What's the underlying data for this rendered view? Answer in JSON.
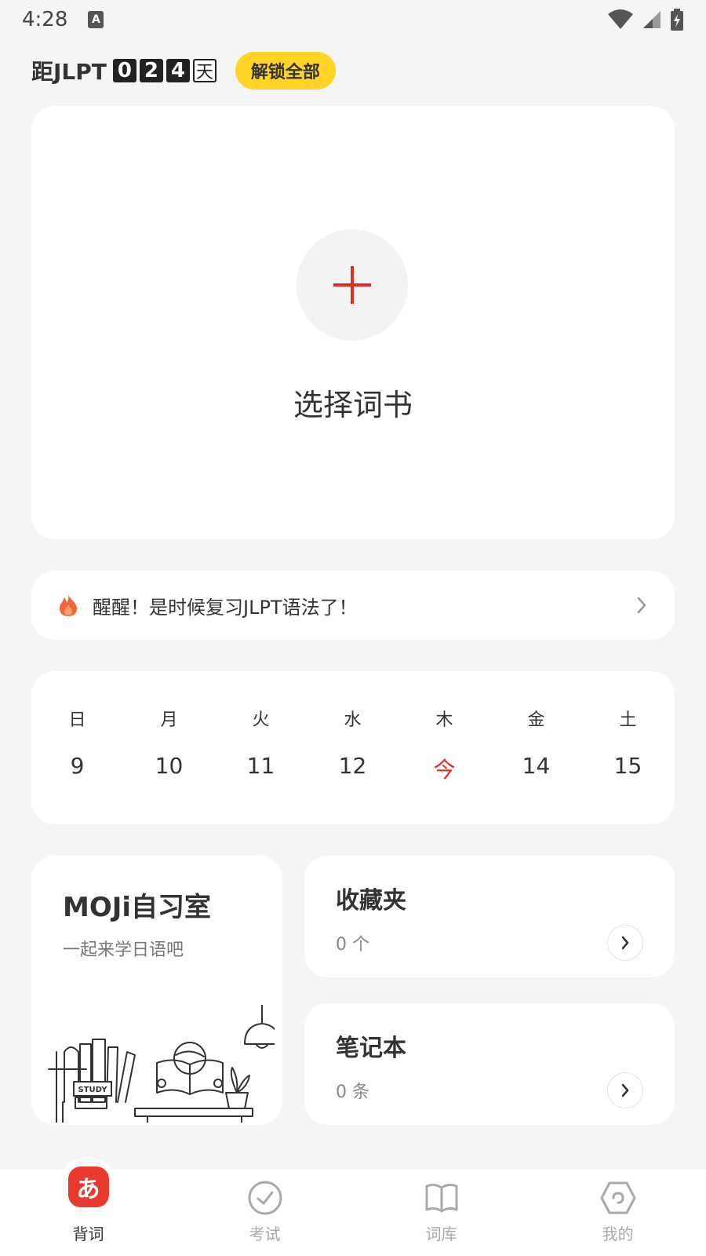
{
  "status_bar": {
    "time": "4:28",
    "notif_badge": "A"
  },
  "header": {
    "countdown_prefix": "距JLPT",
    "digits": [
      "0",
      "2",
      "4"
    ],
    "unit": "天",
    "unlock_label": "解锁全部"
  },
  "book_card": {
    "title": "选择词书"
  },
  "reminder": {
    "text": "醒醒！是时候复习JLPT语法了！"
  },
  "calendar": {
    "weekdays": [
      "日",
      "月",
      "火",
      "水",
      "木",
      "金",
      "土"
    ],
    "dates": [
      "9",
      "10",
      "11",
      "12",
      "今",
      "14",
      "15"
    ]
  },
  "study_room": {
    "title": "MOJi自习室",
    "subtitle": "一起来学日语吧",
    "sign_text": "STUDY"
  },
  "favorites": {
    "title": "收藏夹",
    "count": "0 个"
  },
  "notebook": {
    "title": "笔记本",
    "count": "0 条"
  },
  "bottom_nav": {
    "items": [
      {
        "label": "背词",
        "icon_text": "あ"
      },
      {
        "label": "考试"
      },
      {
        "label": "词库"
      },
      {
        "label": "我的"
      }
    ]
  },
  "colors": {
    "accent": "#e22b23",
    "unlock_bg": "#ffd426",
    "kana_badge": "#e83a2e"
  }
}
